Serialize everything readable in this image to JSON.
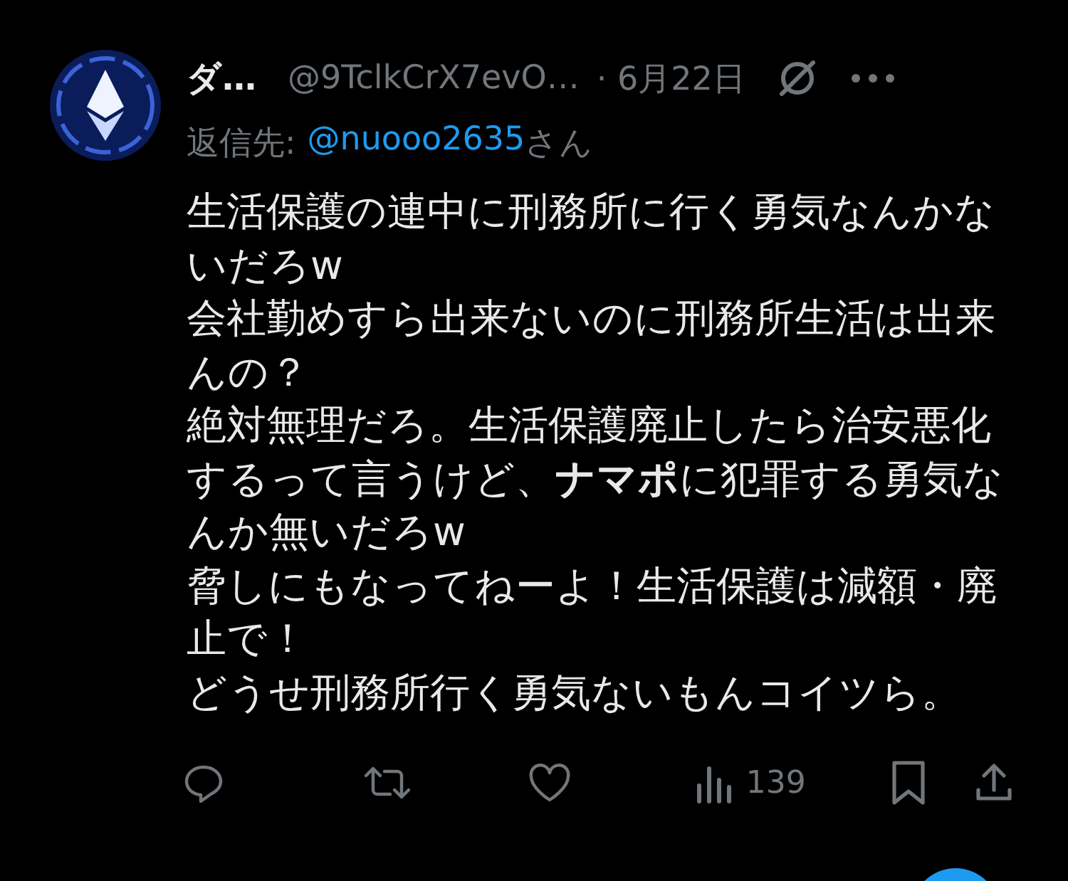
{
  "post": {
    "display_name": "ダ…",
    "handle": "@9TclkCrX7evO…",
    "date": "· 6月22日",
    "reply_to_label": "返信先:",
    "reply_to_handle": "@nuooo2635",
    "reply_to_suffix": "さん",
    "body": [
      "生活保護の連中に刑務所に行く勇気なんかないだろw",
      "会社勤めすら出来ないのに刑務所生活は出来んの？",
      "絶対無理だろ。生活保護廃止したら治安悪化するって言うけど、**ナマポ**に犯罪する勇気なんか無いだろw",
      "脅しにもなってねーよ！生活保護は減額・廃止で！",
      "どうせ刑務所行く勇気ないもんコイツら。"
    ],
    "view_count": "139"
  }
}
